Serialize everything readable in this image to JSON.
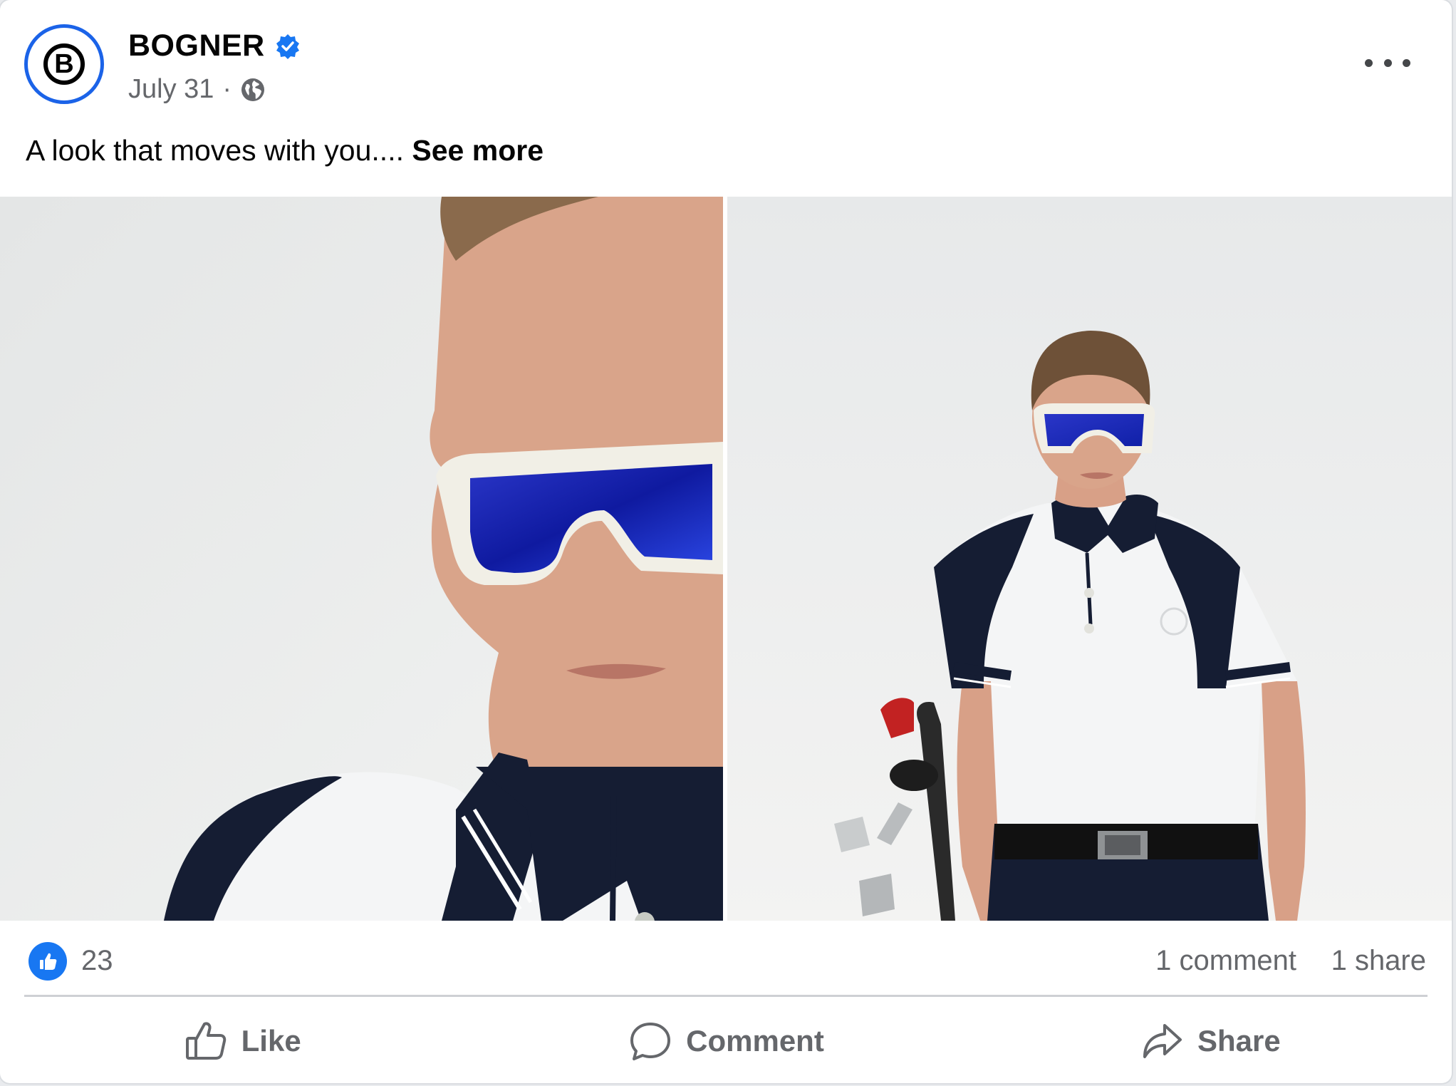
{
  "post": {
    "author": "BOGNER",
    "avatar_letter": "B",
    "verified": true,
    "date": "July 31",
    "separator": "·",
    "audience_icon": "globe-icon",
    "more_icon": "more-options-icon",
    "caption": "A look that moves with you....",
    "see_more": "See more"
  },
  "media": {
    "images": [
      {
        "name": "close-up of model in blue mirrored sunglasses and navy-white polo"
      },
      {
        "name": "model standing in white polo with navy panels beside golf clubs"
      }
    ]
  },
  "stats": {
    "reaction_icon": "like-icon",
    "reaction_count": "23",
    "comments": "1 comment",
    "shares": "1 share"
  },
  "actions": {
    "like": "Like",
    "comment": "Comment",
    "share": "Share"
  },
  "colors": {
    "accent": "#1877f2",
    "avatar_ring": "#1b63e8",
    "muted_text": "#65676b",
    "divider": "#ced0d4"
  }
}
